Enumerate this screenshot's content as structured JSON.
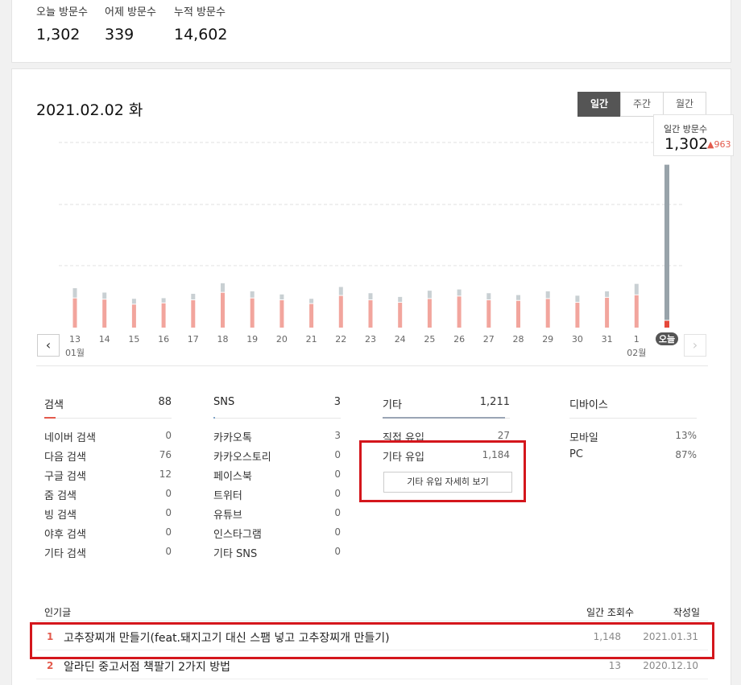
{
  "summary": {
    "today_label": "오늘 방문수",
    "today_value": "1,302",
    "yesterday_label": "어제 방문수",
    "yesterday_value": "339",
    "total_label": "누적 방문수",
    "total_value": "14,602"
  },
  "date_title": "2021.02.02 화",
  "period_tabs": [
    "일간",
    "주간",
    "월간"
  ],
  "tooltip": {
    "label": "일간 방문수",
    "value": "1,302",
    "change": "963"
  },
  "chart_data": {
    "type": "bar",
    "categories": [
      "13",
      "14",
      "15",
      "16",
      "17",
      "18",
      "19",
      "20",
      "21",
      "22",
      "23",
      "24",
      "25",
      "26",
      "27",
      "28",
      "29",
      "30",
      "31",
      "1",
      "오늘"
    ],
    "month_labels": {
      "13": "01월",
      "1": "02월"
    },
    "series": [
      {
        "values": [
          235,
          225,
          185,
          195,
          220,
          280,
          235,
          220,
          190,
          255,
          220,
          200,
          230,
          250,
          220,
          215,
          230,
          200,
          240,
          260,
          55
        ]
      },
      {
        "values": [
          75,
          50,
          40,
          35,
          45,
          70,
          50,
          40,
          35,
          65,
          50,
          40,
          60,
          50,
          50,
          40,
          55,
          50,
          45,
          85,
          1247
        ]
      }
    ],
    "colors": {
      "series_lower": "#f2a59d",
      "series_upper": "#c9d0d3",
      "today_lower": "#e5483a",
      "today_upper": "#98a3aa"
    },
    "ylim": [
      0,
      1500
    ],
    "grid": true
  },
  "sections": {
    "search": {
      "title": "검색",
      "total": "88",
      "color": "#e35a4c",
      "rows": [
        {
          "label": "네이버 검색",
          "value": "0"
        },
        {
          "label": "다음 검색",
          "value": "76"
        },
        {
          "label": "구글 검색",
          "value": "12"
        },
        {
          "label": "줌 검색",
          "value": "0"
        },
        {
          "label": "빙 검색",
          "value": "0"
        },
        {
          "label": "야후 검색",
          "value": "0"
        },
        {
          "label": "기타 검색",
          "value": "0"
        }
      ]
    },
    "sns": {
      "title": "SNS",
      "total": "3",
      "color": "#7fa3c7",
      "rows": [
        {
          "label": "카카오톡",
          "value": "3"
        },
        {
          "label": "카카오스토리",
          "value": "0"
        },
        {
          "label": "페이스북",
          "value": "0"
        },
        {
          "label": "트위터",
          "value": "0"
        },
        {
          "label": "유튜브",
          "value": "0"
        },
        {
          "label": "인스타그램",
          "value": "0"
        },
        {
          "label": "기타 SNS",
          "value": "0"
        }
      ]
    },
    "other": {
      "title": "기타",
      "total": "1,211",
      "color": "#9aa4b4",
      "rows": [
        {
          "label": "직접 유입",
          "value": "27"
        },
        {
          "label": "기타 유입",
          "value": "1,184"
        }
      ],
      "detail_button": "기타 유입 자세히 보기"
    },
    "device": {
      "title": "디바이스",
      "rows": [
        {
          "label": "모바일",
          "value": "13%"
        },
        {
          "label": "PC",
          "value": "87%"
        }
      ]
    }
  },
  "popular": {
    "col_title": "인기글",
    "col_views": "일간 조회수",
    "col_date": "작성일",
    "items": [
      {
        "rank": "1",
        "title": "고추장찌개 만들기(feat.돼지고기 대신 스팸 넣고 고추장찌개 만들기)",
        "views": "1,148",
        "date": "2021.01.31"
      },
      {
        "rank": "2",
        "title": "알라딘 중고서점 책팔기 2가지 방법",
        "views": "13",
        "date": "2020.12.10"
      }
    ]
  }
}
